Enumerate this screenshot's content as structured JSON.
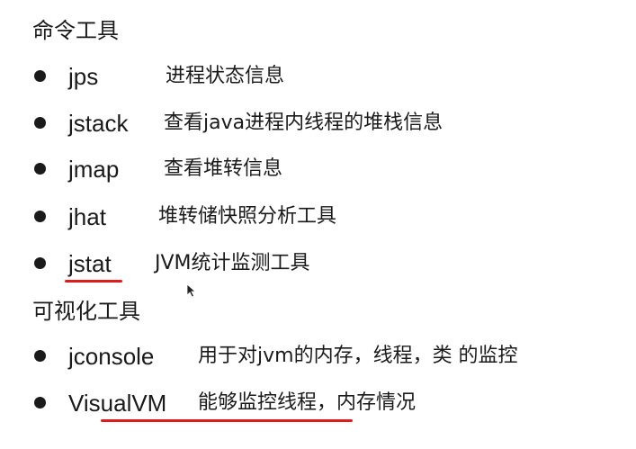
{
  "sections": [
    {
      "heading": "命令工具",
      "items": [
        {
          "name": "jps",
          "desc": "进程状态信息"
        },
        {
          "name": "jstack",
          "desc": "查看java进程内线程的堆栈信息"
        },
        {
          "name": "jmap",
          "desc": "查看堆转信息"
        },
        {
          "name": "jhat",
          "desc": "堆转储快照分析工具"
        },
        {
          "name": "jstat",
          "desc": "JVM统计监测工具"
        }
      ]
    },
    {
      "heading": "可视化工具",
      "items": [
        {
          "name": "jconsole",
          "desc": "用于对jvm的内存，线程，类 的监控"
        },
        {
          "name": "VisualVM",
          "desc": "能够监控线程，内存情况"
        }
      ]
    }
  ],
  "colors": {
    "text": "#1a1a1a",
    "underline": "#e01c1c",
    "background": "#ffffff"
  },
  "icons": {
    "bullet": "filled-circle",
    "cursor": "mouse-pointer-icon"
  }
}
